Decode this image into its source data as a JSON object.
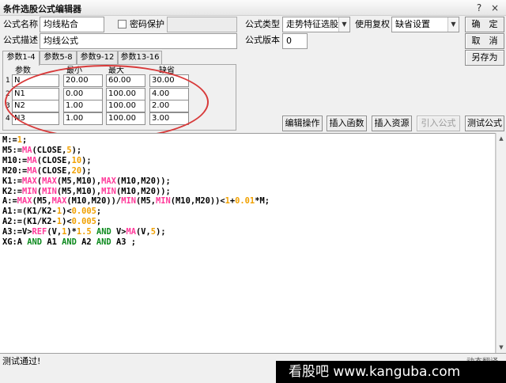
{
  "window": {
    "title": "条件选股公式编辑器",
    "help_glyph": "?",
    "close_glyph": "×"
  },
  "form": {
    "name_label": "公式名称",
    "name_value": "均线粘合",
    "password_label": "密码保护",
    "type_label": "公式类型",
    "type_value": "走势特征选股",
    "reuse_label": "使用复权",
    "reuse_value": "缺省设置",
    "desc_label": "公式描述",
    "desc_value": "均线公式",
    "version_label": "公式版本",
    "version_value": "0"
  },
  "buttons": {
    "ok": "确　定",
    "cancel": "取　消",
    "save_as": "另存为",
    "edit_op": "编辑操作",
    "insert_func": "插入函数",
    "insert_res": "插入资源",
    "import_formula": "引入公式",
    "test_formula": "测试公式"
  },
  "tabs": [
    "参数1-4",
    "参数5-8",
    "参数9-12",
    "参数13-16"
  ],
  "params": {
    "headers": [
      "参数",
      "最小",
      "最大",
      "缺省"
    ],
    "rows": [
      {
        "index": "1",
        "name": "N",
        "min": "20.00",
        "max": "60.00",
        "default": "30.00"
      },
      {
        "index": "2",
        "name": "N1",
        "min": "0.00",
        "max": "100.00",
        "default": "4.00"
      },
      {
        "index": "3",
        "name": "N2",
        "min": "1.00",
        "max": "100.00",
        "default": "2.00"
      },
      {
        "index": "4",
        "name": "N3",
        "min": "1.00",
        "max": "100.00",
        "default": "3.00"
      }
    ]
  },
  "code_lines": [
    "M:=1;",
    "M5:=MA(CLOSE,5);",
    "M10:=MA(CLOSE,10);",
    "M20:=MA(CLOSE,20);",
    "K1:=MAX(MAX(M5,M10),MAX(M10,M20));",
    "K2:=MIN(MIN(M5,M10),MIN(M10,M20));",
    "A:=MAX(M5,MAX(M10,M20))/MIN(M5,MIN(M10,M20))<1+0.01*M;",
    "A1:=(K1/K2-1)<0.005;",
    "A2:=(K1/K2-1)<0.005;",
    "A3:=V>REF(V,1)*1.5 AND V>MA(V,5);",
    "XG:A AND A1 AND A2 AND A3 ;"
  ],
  "status": {
    "message": "测试通过!",
    "dynamic_label": "动态翻译"
  },
  "watermark": "看股吧 www.kanguba.com",
  "colors": {
    "function": "#ff3a9a",
    "number": "#f0a000",
    "keyword": "#0d8a1e",
    "annotation": "#d83a3a"
  }
}
